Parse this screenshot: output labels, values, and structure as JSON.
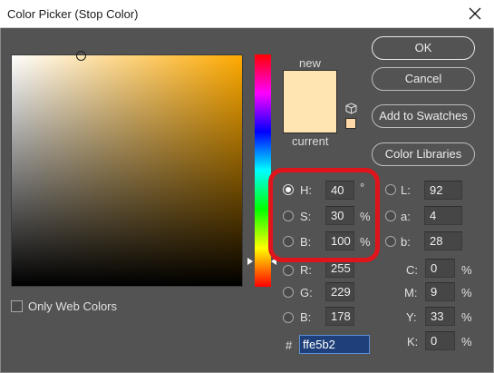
{
  "window": {
    "title": "Color Picker (Stop Color)"
  },
  "colors": {
    "new": "#ffe5b2",
    "current": "#ffe5b2",
    "gamut": "#ffd8a8",
    "highlight": "#e0141b"
  },
  "swatch": {
    "new_label": "new",
    "current_label": "current"
  },
  "buttons": {
    "ok": "OK",
    "cancel": "Cancel",
    "add_to_swatches": "Add to Swatches",
    "color_libraries": "Color Libraries"
  },
  "hsb": {
    "h": {
      "label": "H:",
      "value": "40",
      "unit": "°",
      "selected": true
    },
    "s": {
      "label": "S:",
      "value": "30",
      "unit": "%"
    },
    "b": {
      "label": "B:",
      "value": "100",
      "unit": "%"
    }
  },
  "rgb": {
    "r": {
      "label": "R:",
      "value": "255"
    },
    "g": {
      "label": "G:",
      "value": "229"
    },
    "b": {
      "label": "B:",
      "value": "178"
    }
  },
  "lab": {
    "l": {
      "label": "L:",
      "value": "92"
    },
    "a": {
      "label": "a:",
      "value": "4"
    },
    "b": {
      "label": "b:",
      "value": "28"
    }
  },
  "cmyk": {
    "c": {
      "label": "C:",
      "value": "0",
      "unit": "%"
    },
    "m": {
      "label": "M:",
      "value": "9",
      "unit": "%"
    },
    "y": {
      "label": "Y:",
      "value": "33",
      "unit": "%"
    },
    "k": {
      "label": "K:",
      "value": "0",
      "unit": "%"
    }
  },
  "hex": {
    "label": "#",
    "value": "ffe5b2"
  },
  "web_only": {
    "label": "Only Web Colors",
    "checked": false
  },
  "icons": {
    "close": "close-icon",
    "cube": "cube-icon"
  }
}
